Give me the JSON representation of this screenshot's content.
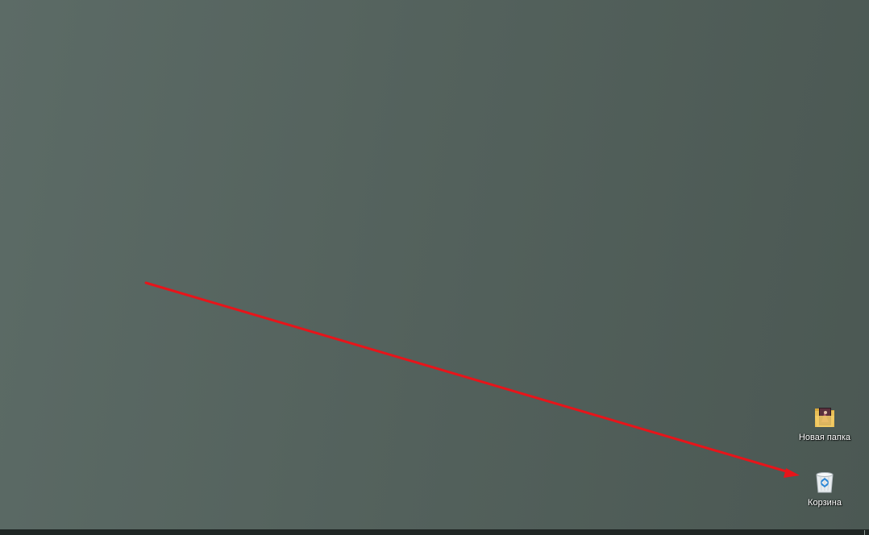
{
  "desktop": {
    "icons": [
      {
        "label": "Новая папка",
        "icon": "folder-icon"
      },
      {
        "label": "Корзина",
        "icon": "recycle-bin-icon"
      }
    ]
  },
  "annotation": {
    "arrow_color": "#e8141a",
    "target": "Корзина"
  },
  "colors": {
    "wallpaper": "#56645f",
    "taskbar": "#1f2624"
  }
}
